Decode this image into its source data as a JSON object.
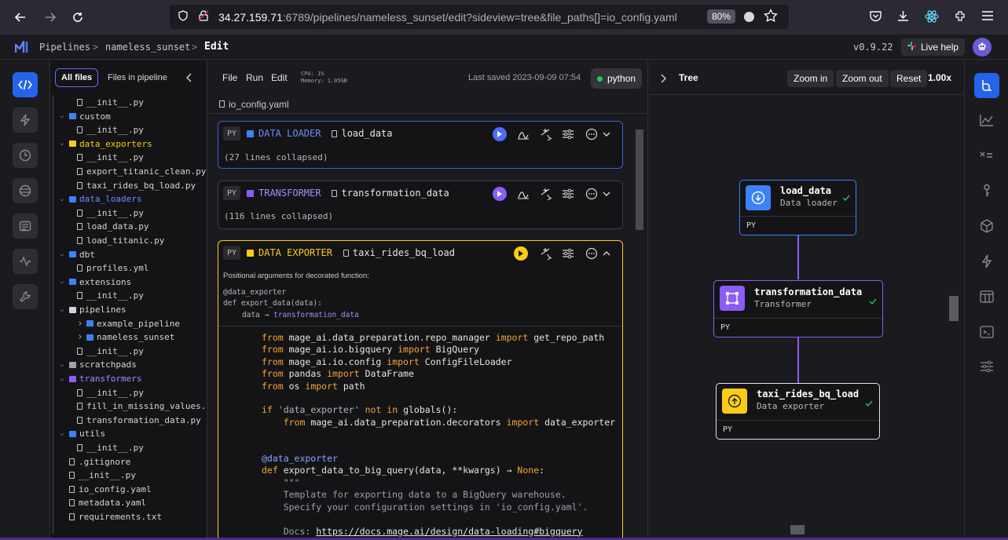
{
  "browser": {
    "url_host": "34.27.159.71",
    "url_path": ":6789/pipelines/nameless_sunset/edit?sideview=tree&file_paths[]=io_config.yaml",
    "zoom": "80%"
  },
  "header": {
    "crumb1": "Pipelines",
    "crumb2": "nameless_sunset",
    "crumb3": "Edit",
    "version": "v0.9.22",
    "live_help": "Live help"
  },
  "files": {
    "tab_all": "All files",
    "tab_pipeline": "Files in pipeline",
    "rows": [
      {
        "label": "__init__.py",
        "type": "file"
      },
      {
        "label": "custom",
        "type": "folder",
        "color": "#3b82f6"
      },
      {
        "label": "__init__.py",
        "type": "file"
      },
      {
        "label": "data_exporters",
        "type": "folder",
        "color": "#facc15"
      },
      {
        "label": "__init__.py",
        "type": "file"
      },
      {
        "label": "export_titanic_clean.py",
        "type": "file"
      },
      {
        "label": "taxi_rides_bq_load.py",
        "type": "file"
      },
      {
        "label": "data_loaders",
        "type": "folder",
        "color": "#3b82f6"
      },
      {
        "label": "__init__.py",
        "type": "file"
      },
      {
        "label": "load_data.py",
        "type": "file"
      },
      {
        "label": "load_titanic.py",
        "type": "file"
      },
      {
        "label": "dbt",
        "type": "folder",
        "color": "#3b82f6"
      },
      {
        "label": "profiles.yml",
        "type": "file"
      },
      {
        "label": "extensions",
        "type": "folder",
        "color": "#3b82f6"
      },
      {
        "label": "__init__.py",
        "type": "file"
      },
      {
        "label": "pipelines",
        "type": "folder",
        "color": "#d4d4d8"
      },
      {
        "label": "example_pipeline",
        "type": "folder",
        "color": "#3b82f6"
      },
      {
        "label": "nameless_sunset",
        "type": "folder",
        "color": "#3b82f6"
      },
      {
        "label": "__init__.py",
        "type": "file"
      },
      {
        "label": "scratchpads",
        "type": "folder",
        "color": "#9ca3af"
      },
      {
        "label": "transformers",
        "type": "folder",
        "color": "#8b5cf6"
      },
      {
        "label": "__init__.py",
        "type": "file"
      },
      {
        "label": "fill_in_missing_values.py",
        "type": "file"
      },
      {
        "label": "transformation_data.py",
        "type": "file"
      },
      {
        "label": "utils",
        "type": "folder",
        "color": "#3b82f6"
      },
      {
        "label": "__init__.py",
        "type": "file"
      },
      {
        "label": ".gitignore",
        "type": "file"
      },
      {
        "label": "__init__.py",
        "type": "file"
      },
      {
        "label": "io_config.yaml",
        "type": "file"
      },
      {
        "label": "metadata.yaml",
        "type": "file"
      },
      {
        "label": "requirements.txt",
        "type": "file"
      }
    ]
  },
  "editor": {
    "menu_file": "File",
    "menu_run": "Run",
    "menu_edit": "Edit",
    "cpu": "CPU: 1%",
    "memory": "Memory: 1.05GB",
    "last_saved": "Last saved 2023-09-09 07:54",
    "kernel": "python",
    "path": "io_config.yaml",
    "block1": {
      "py": "PY",
      "type": "DATA LOADER",
      "name": "load_data",
      "collapsed": "(27 lines collapsed)"
    },
    "block2": {
      "py": "PY",
      "type": "TRANSFORMER",
      "name": "transformation_data",
      "collapsed": "(116 lines collapsed)"
    },
    "block3": {
      "py": "PY",
      "type": "DATA EXPORTER",
      "name": "taxi_rides_bq_load",
      "pos_args": "Positional arguments for decorated function:",
      "sig1": "@data_exporter",
      "sig2": "def export_data(data):",
      "sig3_a": "data",
      "sig3_arrow": "→",
      "sig3_b": "transformation_data"
    }
  },
  "tree": {
    "title": "Tree",
    "zoom_in": "Zoom in",
    "zoom_out": "Zoom out",
    "reset": "Reset",
    "zoom_level": "1.00x",
    "nodes": [
      {
        "name": "load_data",
        "type": "Data loader",
        "lang": "PY"
      },
      {
        "name": "transformation_data",
        "type": "Transformer",
        "lang": "PY"
      },
      {
        "name": "taxi_rides_bq_load",
        "type": "Data exporter",
        "lang": "PY"
      }
    ]
  },
  "colors": {
    "accent": "#2563eb",
    "loader": "#3b82f6",
    "transformer": "#8b5cf6",
    "exporter": "#facc15"
  }
}
